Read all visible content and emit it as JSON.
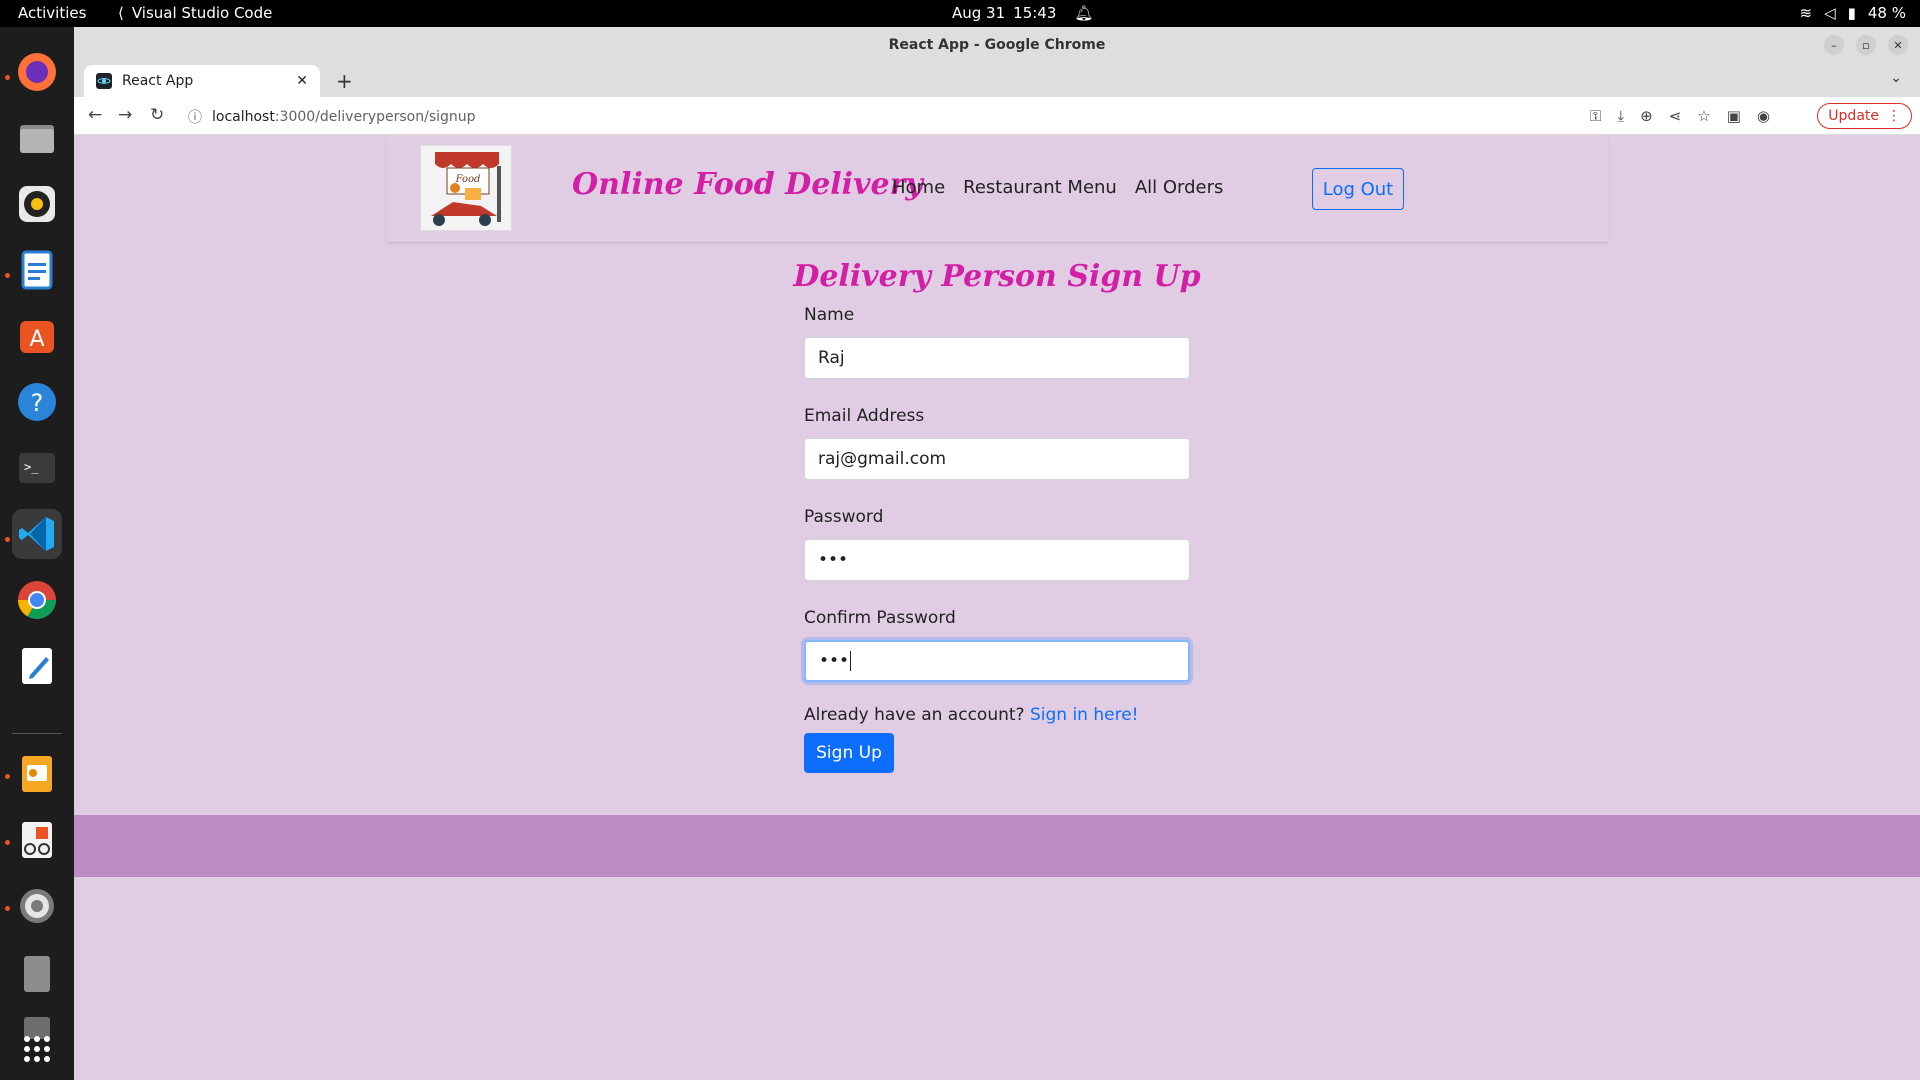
{
  "os": {
    "activities": "Activities",
    "active_app": "Visual Studio Code",
    "date": "Aug 31",
    "time": "15:43",
    "battery": "48 %"
  },
  "browser": {
    "window_title": "React App - Google Chrome",
    "tab_title": "React App",
    "url_host": "localhost",
    "url_path": ":3000/deliveryperson/signup",
    "update_label": "Update"
  },
  "navbar": {
    "brand": "Online Food Delivery",
    "links": [
      "Home",
      "Restaurant Menu",
      "All Orders"
    ],
    "logout_label": "Log Out"
  },
  "form": {
    "title": "Delivery Person Sign Up",
    "name_label": "Name",
    "name_value": "Raj",
    "email_label": "Email Address",
    "email_value": "raj@gmail.com",
    "password_label": "Password",
    "password_value": "•••",
    "confirm_label": "Confirm Password",
    "confirm_value": "•••",
    "signin_prompt": "Already have an account?",
    "signin_link": "Sign in here!",
    "submit_label": "Sign Up"
  },
  "colors": {
    "brand_pink": "#d21fa6",
    "page_bg": "#e0cde3",
    "footer_bg": "#bb8bc3",
    "primary": "#0d6efd"
  }
}
